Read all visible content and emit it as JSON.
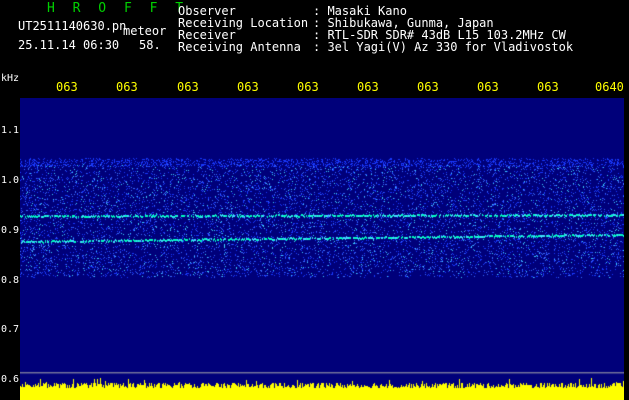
{
  "header": {
    "station_title": "H R O F F T",
    "filename": "UT2511140630.pn",
    "mode": "meteor",
    "datetime": "25.11.14 06:30",
    "count": "58."
  },
  "info": [
    {
      "key": "Observer",
      "value": ": Masaki Kano"
    },
    {
      "key": "Receiving Location",
      "value": ": Shibukawa, Gunma, Japan"
    },
    {
      "key": "Receiver",
      "value": ": RTL-SDR SDR# 43dB L15 103.2MHz CW"
    },
    {
      "key": "Receiving Antenna",
      "value": ": 3el Yagi(V) Az 330 for Vladivostok"
    }
  ],
  "chart_data": {
    "type": "heatmap",
    "ylabel": "kHz",
    "y_ticks": [
      "1.1",
      "1.0",
      "0.9",
      "0.8",
      "0.7",
      "0.6"
    ],
    "x_ticks": [
      "063",
      "063",
      "063",
      "063",
      "063",
      "063",
      "063",
      "063",
      "063",
      "0640"
    ],
    "ylim": [
      0.6,
      1.15
    ],
    "band_range": [
      0.8,
      1.02
    ],
    "signal_lines": [
      0.92,
      0.87
    ],
    "colors": {
      "background": "#00007a",
      "noise": "#3a6cff",
      "signal": "#00ffc0",
      "level_bar": "#ffff00",
      "grid": "#aaaaaa"
    }
  }
}
